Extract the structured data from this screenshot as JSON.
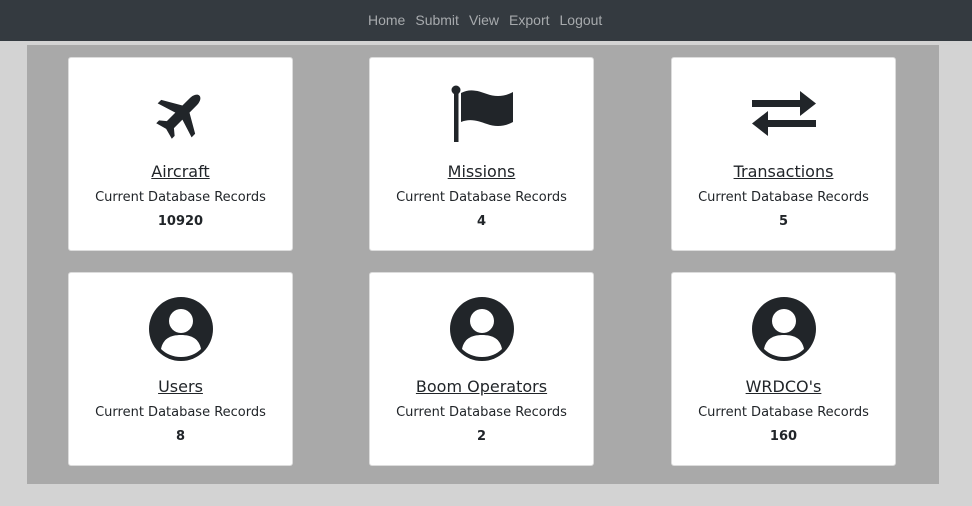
{
  "nav": {
    "items": [
      "Home",
      "Submit",
      "View",
      "Export",
      "Logout"
    ]
  },
  "cards": [
    {
      "title": "Aircraft",
      "subtitle": "Current Database Records",
      "count": "10920",
      "icon": "airplane-icon"
    },
    {
      "title": "Missions",
      "subtitle": "Current Database Records",
      "count": "4",
      "icon": "flag-icon"
    },
    {
      "title": "Transactions",
      "subtitle": "Current Database Records",
      "count": "5",
      "icon": "exchange-arrows-icon"
    },
    {
      "title": "Users",
      "subtitle": "Current Database Records",
      "count": "8",
      "icon": "user-circle-icon"
    },
    {
      "title": "Boom Operators",
      "subtitle": "Current Database Records",
      "count": "2",
      "icon": "user-circle-icon"
    },
    {
      "title": "WRDCO's",
      "subtitle": "Current Database Records",
      "count": "160",
      "icon": "user-circle-icon"
    }
  ],
  "colors": {
    "navbar": "#343a40",
    "nav_text": "#a7aaad",
    "page_bg": "#d3d3d3",
    "panel_bg": "#a9a9a9",
    "icon": "#212529"
  }
}
